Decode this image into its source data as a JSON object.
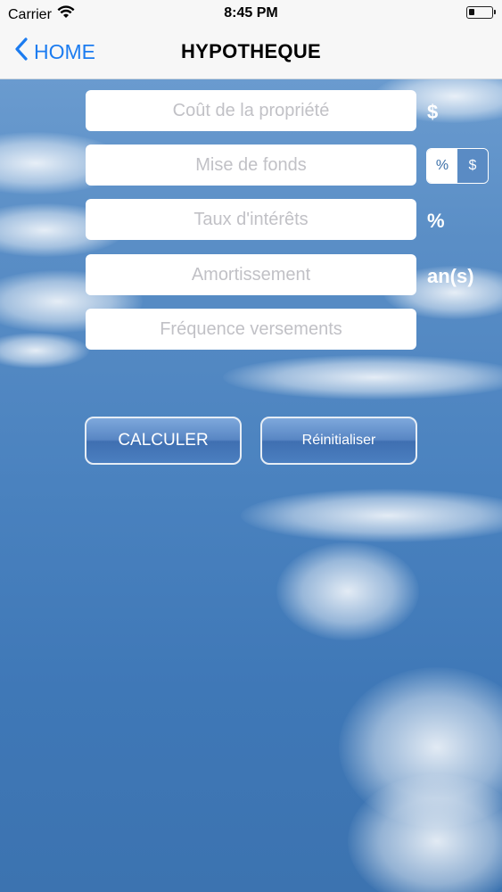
{
  "status_bar": {
    "carrier": "Carrier",
    "time": "8:45 PM",
    "battery_level": 0.25
  },
  "nav": {
    "back_label": "HOME",
    "title": "HYPOTHEQUE",
    "accent_color": "#1c7cf0"
  },
  "form": {
    "cost": {
      "placeholder": "Coût de la propriété",
      "value": "",
      "suffix": "$"
    },
    "down_payment": {
      "placeholder": "Mise de fonds",
      "value": "",
      "unit_options": [
        "%",
        "$"
      ],
      "selected_unit": "%"
    },
    "interest": {
      "placeholder": "Taux d'intérêts",
      "value": "",
      "suffix": "%"
    },
    "amortization": {
      "placeholder": "Amortissement",
      "value": "",
      "suffix": "an(s)"
    },
    "frequency": {
      "placeholder": "Fréquence versements",
      "value": ""
    }
  },
  "buttons": {
    "calculate": "CALCULER",
    "reset": "Réinitialiser"
  },
  "icons": {
    "back": "chevron-left-icon",
    "wifi": "wifi-icon",
    "battery": "battery-icon"
  },
  "background": "sky-with-clouds"
}
